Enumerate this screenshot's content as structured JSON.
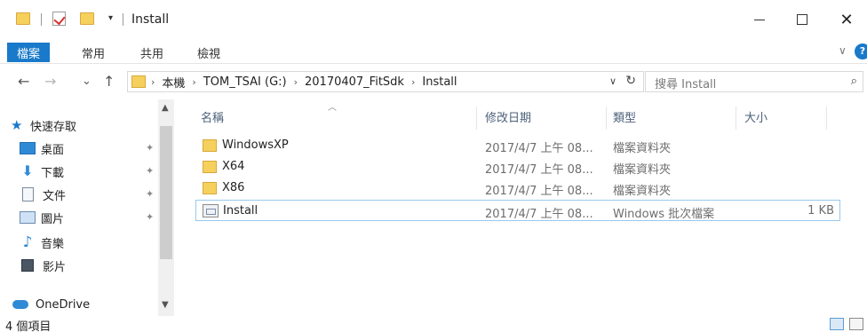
{
  "window": {
    "title": "Install",
    "qa_dropdown_glyph": "▾",
    "minimize_label": "",
    "close_glyph": "✕"
  },
  "ribbon": {
    "tabs": [
      "檔案",
      "常用",
      "共用",
      "檢視"
    ],
    "collapse_glyph": "∨",
    "help_glyph": "?",
    "accent_color": "#1979ca"
  },
  "nav": {
    "back_glyph": "←",
    "forward_glyph": "→",
    "recent_glyph": "⌄",
    "up_glyph": "↑"
  },
  "address": {
    "crumbs": [
      "本機",
      "TOM_TSAI (G:)",
      "20170407_FitSdk",
      "Install"
    ],
    "separator": "›",
    "dropdown_glyph": "∨",
    "refresh_glyph": "↻"
  },
  "search": {
    "placeholder": "搜尋 Install",
    "icon_glyph": "⌕"
  },
  "sidebar": {
    "items": [
      {
        "label": "快速存取",
        "icon": "star-icon",
        "pinned": false
      },
      {
        "label": "桌面",
        "icon": "desktop-icon",
        "pinned": true
      },
      {
        "label": "下載",
        "icon": "download-icon",
        "pinned": true
      },
      {
        "label": "文件",
        "icon": "document-icon",
        "pinned": true
      },
      {
        "label": "圖片",
        "icon": "pictures-icon",
        "pinned": true
      },
      {
        "label": "音樂",
        "icon": "music-icon",
        "pinned": false
      },
      {
        "label": "影片",
        "icon": "video-icon",
        "pinned": false
      },
      {
        "label": "OneDrive",
        "icon": "cloud-icon",
        "pinned": false
      }
    ],
    "pin_glyph": "📌"
  },
  "columns": {
    "name": "名稱",
    "date": "修改日期",
    "type": "類型",
    "size": "大小"
  },
  "files": [
    {
      "name": "WindowsXP",
      "date": "2017/4/7 上午 08...",
      "type": "檔案資料夾",
      "size": "",
      "kind": "folder"
    },
    {
      "name": "X64",
      "date": "2017/4/7 上午 08...",
      "type": "檔案資料夾",
      "size": "",
      "kind": "folder"
    },
    {
      "name": "X86",
      "date": "2017/4/7 上午 08...",
      "type": "檔案資料夾",
      "size": "",
      "kind": "folder"
    },
    {
      "name": "Install",
      "date": "2017/4/7 上午 08...",
      "type": "Windows 批次檔案",
      "size": "1 KB",
      "kind": "batch"
    }
  ],
  "status": {
    "item_count": "4 個項目"
  }
}
